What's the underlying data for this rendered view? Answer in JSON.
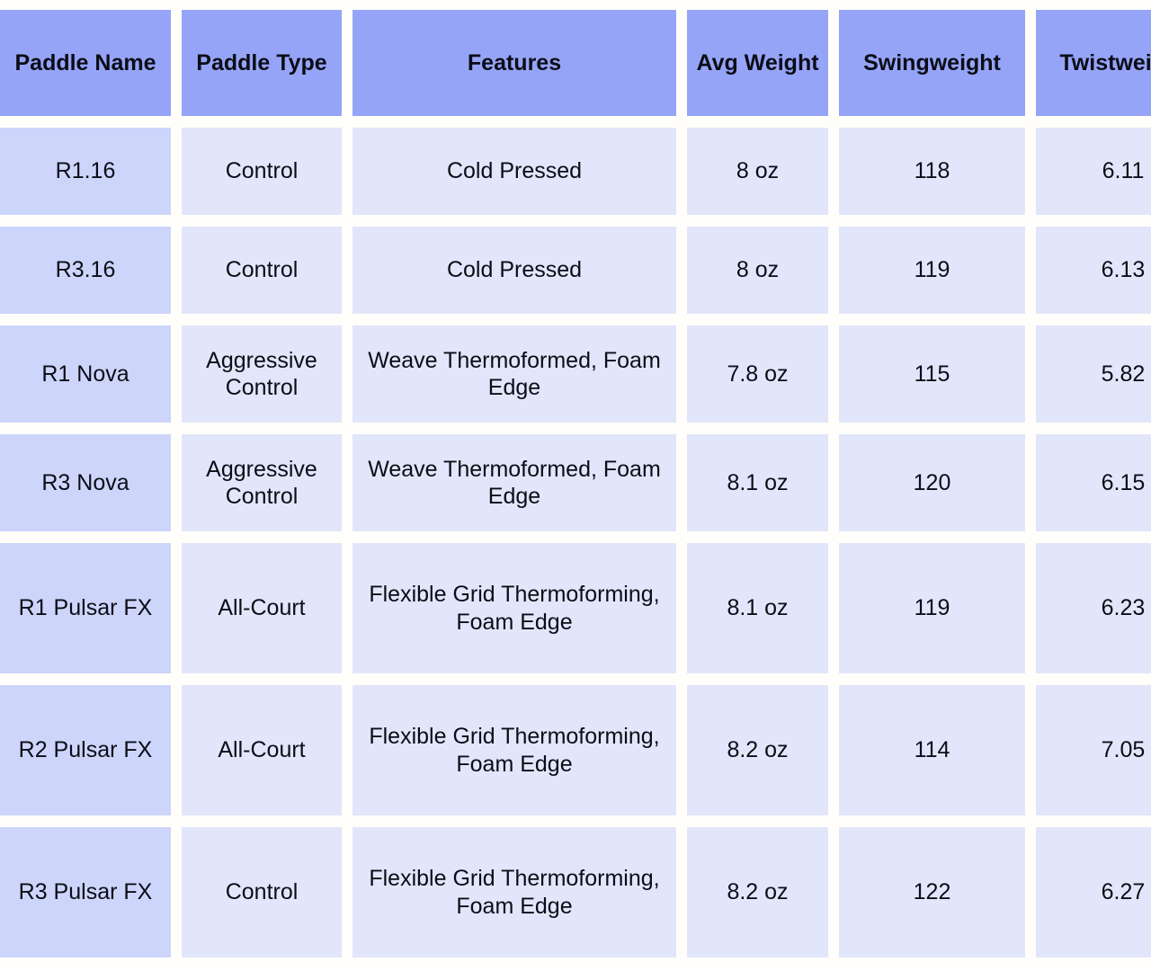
{
  "table": {
    "columns": [
      {
        "key": "paddle_name",
        "label": "Paddle Name"
      },
      {
        "key": "paddle_type",
        "label": "Paddle Type"
      },
      {
        "key": "features",
        "label": "Features"
      },
      {
        "key": "avg_weight",
        "label": "Avg Weight"
      },
      {
        "key": "swingweight",
        "label": "Swingweight"
      },
      {
        "key": "twistweight",
        "label": "Twistweight"
      }
    ],
    "rows": [
      {
        "paddle_name": "R1.16",
        "paddle_type": "Control",
        "features": "Cold Pressed",
        "avg_weight": "8 oz",
        "swingweight": "118",
        "twistweight": "6.11"
      },
      {
        "paddle_name": "R3.16",
        "paddle_type": "Control",
        "features": "Cold Pressed",
        "avg_weight": "8 oz",
        "swingweight": "119",
        "twistweight": "6.13"
      },
      {
        "paddle_name": "R1 Nova",
        "paddle_type": "Aggressive Control",
        "features": "Weave Thermoformed, Foam Edge",
        "avg_weight": "7.8 oz",
        "swingweight": "115",
        "twistweight": "5.82"
      },
      {
        "paddle_name": "R3 Nova",
        "paddle_type": "Aggressive Control",
        "features": "Weave Thermoformed, Foam Edge",
        "avg_weight": "8.1 oz",
        "swingweight": "120",
        "twistweight": "6.15"
      },
      {
        "paddle_name": "R1 Pulsar FX",
        "paddle_type": "All-Court",
        "features": "Flexible Grid Thermoforming, Foam Edge",
        "avg_weight": "8.1 oz",
        "swingweight": "119",
        "twistweight": "6.23"
      },
      {
        "paddle_name": "R2 Pulsar FX",
        "paddle_type": "All-Court",
        "features": "Flexible Grid Thermoforming, Foam Edge",
        "avg_weight": "8.2 oz",
        "swingweight": "114",
        "twistweight": "7.05"
      },
      {
        "paddle_name": "R3 Pulsar FX",
        "paddle_type": "Control",
        "features": "Flexible Grid Thermoforming, Foam Edge",
        "avg_weight": "8.2 oz",
        "swingweight": "122",
        "twistweight": "6.27"
      }
    ]
  },
  "colors": {
    "header_background": "#96A4F8",
    "first_column_background": "#CDD5FB",
    "cell_background": "#E2E6FA",
    "page_background": "#FFFEFB",
    "text": "#0B0D17"
  }
}
